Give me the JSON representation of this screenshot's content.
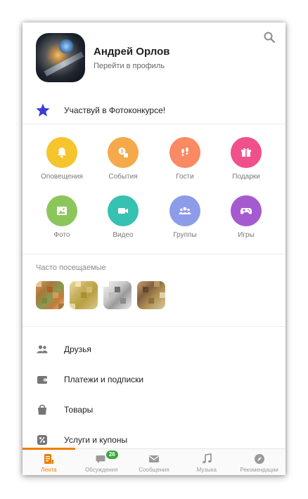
{
  "profile": {
    "name": "Андрей Орлов",
    "link": "Перейти в профиль"
  },
  "contest": {
    "label": "Участвуй в Фотоконкурсе!",
    "icon": "star-icon",
    "color": "#3b3bd8"
  },
  "grid": [
    {
      "label": "Оповещения",
      "icon": "bell-icon",
      "color": "#f6c42d"
    },
    {
      "label": "События",
      "icon": "events-icon",
      "color": "#f5a94b"
    },
    {
      "label": "Гости",
      "icon": "footprints-icon",
      "color": "#f98a63"
    },
    {
      "label": "Подарки",
      "icon": "gift-icon",
      "color": "#f0508c"
    },
    {
      "label": "Фото",
      "icon": "photo-icon",
      "color": "#8bc65b"
    },
    {
      "label": "Видео",
      "icon": "video-icon",
      "color": "#36c1b2"
    },
    {
      "label": "Группы",
      "icon": "groups-icon",
      "color": "#8d9ce8"
    },
    {
      "label": "Игры",
      "icon": "gamepad-icon",
      "color": "#a65ad0"
    }
  ],
  "frequent": {
    "title": "Часто посещаемые"
  },
  "menu": [
    {
      "label": "Друзья",
      "icon": "friends-icon"
    },
    {
      "label": "Платежи и подписки",
      "icon": "wallet-icon"
    },
    {
      "label": "Товары",
      "icon": "shopping-bag-icon"
    },
    {
      "label": "Услуги и купоны",
      "icon": "coupon-icon"
    }
  ],
  "tabs": [
    {
      "label": "Лента",
      "icon": "feed-icon",
      "active": true
    },
    {
      "label": "Обсуждения",
      "icon": "discussions-icon",
      "badge": "26"
    },
    {
      "label": "Сообщения",
      "icon": "messages-icon"
    },
    {
      "label": "Музыка",
      "icon": "music-icon"
    },
    {
      "label": "Рекомендации",
      "icon": "recommendations-icon"
    }
  ],
  "colors": {
    "accent": "#f07c00",
    "badge": "#3aa83a"
  }
}
